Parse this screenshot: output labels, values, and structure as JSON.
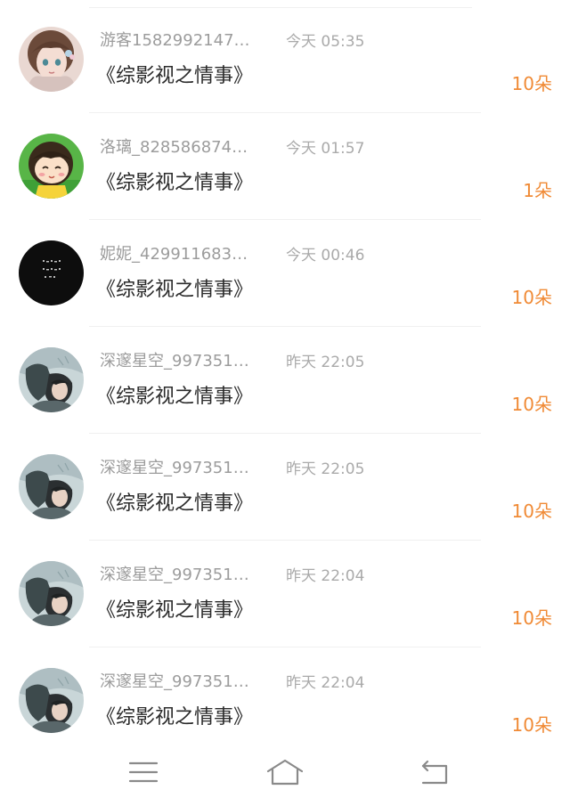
{
  "items": [
    {
      "name": "游客1582992147…",
      "time": "今天 05:35",
      "title": "《综影视之情事》",
      "amount": "10朵",
      "avatar": "anime-girl-avatar"
    },
    {
      "name": "洛璃_828586874…",
      "time": "今天 01:57",
      "title": "《综影视之情事》",
      "amount": "1朵",
      "avatar": "cartoon-kid-avatar"
    },
    {
      "name": "妮妮_429911683…",
      "time": "今天 00:46",
      "title": "《综影视之情事》",
      "amount": "10朵",
      "avatar": "black-text-avatar"
    },
    {
      "name": "深邃星空_997351…",
      "time": "昨天 22:05",
      "title": "《综影视之情事》",
      "amount": "10朵",
      "avatar": "anime-boy-avatar"
    },
    {
      "name": "深邃星空_997351…",
      "time": "昨天 22:05",
      "title": "《综影视之情事》",
      "amount": "10朵",
      "avatar": "anime-boy-avatar"
    },
    {
      "name": "深邃星空_997351…",
      "time": "昨天 22:04",
      "title": "《综影视之情事》",
      "amount": "10朵",
      "avatar": "anime-boy-avatar"
    },
    {
      "name": "深邃星空_997351…",
      "time": "昨天 22:04",
      "title": "《综影视之情事》",
      "amount": "10朵",
      "avatar": "anime-boy-avatar"
    }
  ],
  "navbar": {
    "menu_icon": "menu-icon",
    "home_icon": "home-icon",
    "back_icon": "back-icon"
  },
  "colors": {
    "amount": "#f08a35",
    "username": "#9c9c9c",
    "time": "#aaaaaa",
    "title": "#2b2b2b",
    "divider": "#f0f0f0"
  }
}
